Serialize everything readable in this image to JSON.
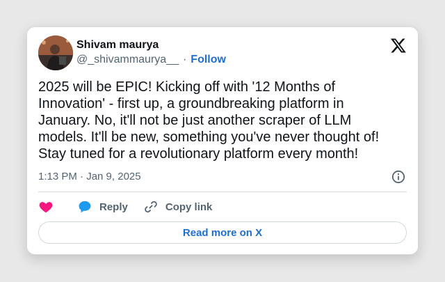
{
  "author": {
    "name": "Shivam maurya",
    "handle": "@_shivammaurya__",
    "separator": "·",
    "follow_label": "Follow"
  },
  "tweet": {
    "text": "2025 will be EPIC! Kicking off with '12 Months of\nInnovation' - first up, a groundbreaking platform in\nJanuary. No, it'll not be just another scraper of LLM\nmodels. It'll be new, something you've never thought of!\nStay tuned for a revolutionary platform every month!",
    "timestamp": "1:13 PM · Jan 9, 2025"
  },
  "actions": {
    "like_icon": "heart-icon",
    "reply_label": "Reply",
    "copy_link_label": "Copy link"
  },
  "read_more_label": "Read more on X",
  "colors": {
    "heart": "#f91880",
    "reply_bubble": "#1d9bf0",
    "link": "#1d6fd1",
    "muted": "#536471"
  }
}
